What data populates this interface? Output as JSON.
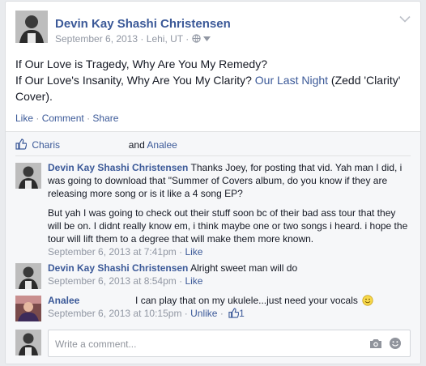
{
  "post": {
    "author": "Devin Kay Shashi Christensen",
    "date": "September 6, 2013",
    "location": "Lehi, UT",
    "text_line1": "If Our Love is Tragedy, Why Are You My Remedy?",
    "text_line2_prefix": "If Our Love's Insanity, Why Are You My Clarity?",
    "text_link": "Our Last Night",
    "text_suffix": "(Zedd 'Clarity' Cover).",
    "actions": {
      "like": "Like",
      "comment": "Comment",
      "share": "Share",
      "sep": "·"
    }
  },
  "likes": {
    "name1": "Charis",
    "conjunction": "and",
    "name2": "Analee"
  },
  "comments": [
    {
      "author": "Devin Kay Shashi Christensen",
      "text_p1": "Thanks Joey, for posting that vid. Yah man I did, i was going to download that \"Summer of Covers album, do you know if they are releasing more song or is it like a 4 song EP?",
      "text_p2": "But yah I was going to check out their stuff soon bc of their bad ass tour that they will be on. I didnt really know em, i think maybe one or two songs i heard. i hope the tour will lift them to a degree that will make them more known.",
      "timestamp": "September 6, 2013 at 7:41pm",
      "like": "Like"
    },
    {
      "author": "Devin Kay Shashi Christensen",
      "text": "Alright sweet man will do",
      "timestamp": "September 6, 2013 at 8:54pm",
      "like": "Like"
    },
    {
      "author": "Analee",
      "text": "I can play that on my ukulele...just need your vocals",
      "timestamp": "September 6, 2013 at 10:15pm",
      "unlike": "Unlike",
      "like_count": "1"
    }
  ],
  "writer": {
    "placeholder": "Write a comment..."
  },
  "icons": {
    "globe": "globe-icon",
    "dropdown": "chevron-down-icon",
    "thumb": "thumbs-up-icon",
    "camera": "camera-icon",
    "emoji": "emoji-icon"
  },
  "colors": {
    "link": "#3b5998",
    "meta": "#9197a3",
    "bg": "#f6f7f9"
  }
}
